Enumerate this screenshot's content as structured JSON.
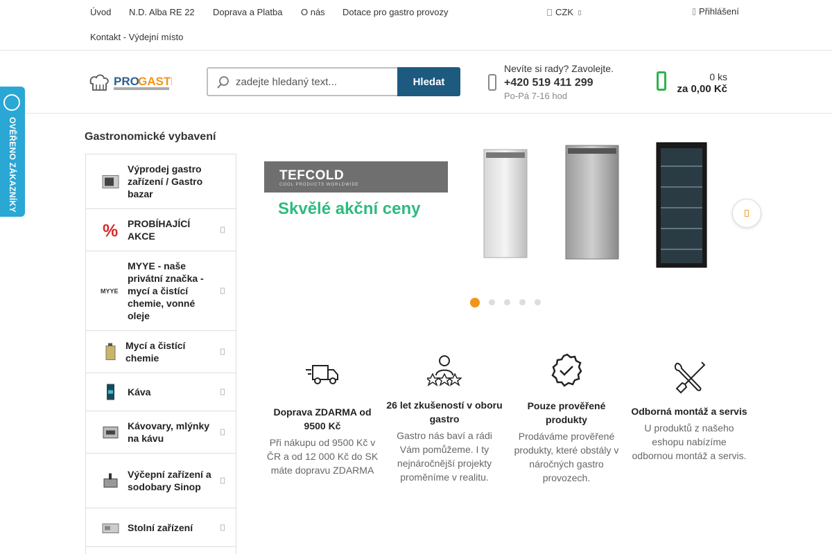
{
  "topnav": {
    "items": [
      "Úvod",
      "N.D. Alba RE 22",
      "Doprava a Platba",
      "O nás",
      "Dotace pro gastro provozy",
      "Kontakt - Výdejní místo"
    ],
    "currency": "CZK",
    "login": "Přihlášení"
  },
  "header": {
    "search_placeholder": "zadejte hledaný text...",
    "search_button": "Hledat",
    "phone_question": "Nevíte si rady? Zavolejte.",
    "phone_number": "+420 519 411 299",
    "phone_hours": "Po-Pá 7-16 hod",
    "cart_qty": "0 ks",
    "cart_sum": "za 0,00 Kč"
  },
  "sidebar": {
    "title": "Gastronomické vybavení",
    "items": [
      {
        "label": "Výprodej gastro zařízení / Gastro bazar"
      },
      {
        "label": "PROBÍHAJÍCÍ AKCE"
      },
      {
        "label": "MYYE - naše privátní značka - mycí a čistící chemie, vonné oleje"
      },
      {
        "label": "Mycí a čistící chemie"
      },
      {
        "label": "Káva"
      },
      {
        "label": "Kávovary, mlýnky na kávu"
      },
      {
        "label": "Výčepní zařízení a sodobary Sinop"
      },
      {
        "label": "Stolní zařízení"
      }
    ]
  },
  "banner": {
    "brand": "TEFCOLD",
    "brand_sub": "COOL PRODUCTS WORLDWIDE",
    "slogan": "Skvělé akční ceny",
    "slide_count": 5,
    "active_slide": 1
  },
  "features": [
    {
      "title": "Doprava ZDARMA od 9500 Kč",
      "text": "Při nákupu od 9500 Kč v ČR a od 12 000 Kč do SK máte dopravu ZDARMA"
    },
    {
      "title": "26 let zkušeností v oboru gastro",
      "text": "Gastro nás baví a rádi Vám pomůžeme. I ty nejnáročnější projekty proměníme v realitu."
    },
    {
      "title": "Pouze prověřené produkty",
      "text": "Prodáváme prověřené produkty, které obstály v náročných gastro provozech."
    },
    {
      "title": "Odborná montáž a servis",
      "text": "U produktů z našeho eshopu nabízíme odbornou montáž a servis."
    }
  ],
  "badge": {
    "text": "OVĚŘENO ZÁKAZNÍKY"
  },
  "colors": {
    "accent": "#1d5a80",
    "cart_green": "#2db34a",
    "dot_active": "#f29419",
    "badge_blue": "#2aa7d4",
    "slogan_green": "#2dbb7e"
  }
}
